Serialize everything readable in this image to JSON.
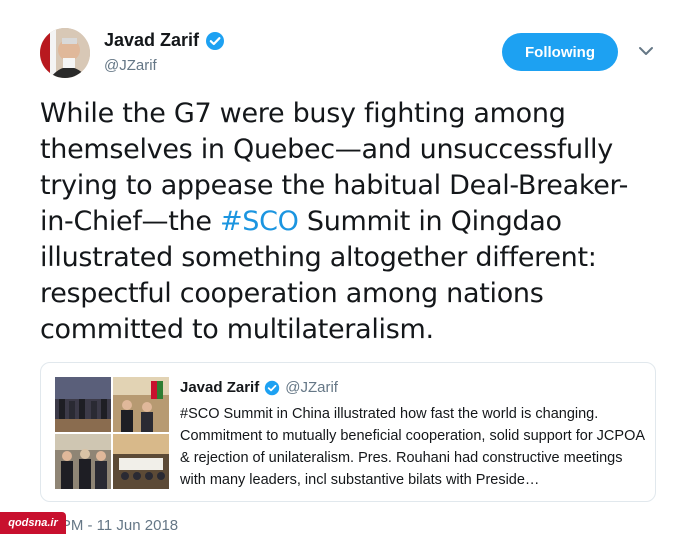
{
  "author": {
    "name": "Javad Zarif",
    "handle": "@JZarif",
    "verified_color": "#1da1f2"
  },
  "follow_button": {
    "label": "Following",
    "color": "#1da1f2"
  },
  "tweet": {
    "text_before": "While the G7 were busy fighting among themselves in Quebec—and unsuccessfully trying to appease the habitual Deal-Breaker-in-Chief—the ",
    "hashtag": "#SCO",
    "text_after": " Summit in Qingdao illustrated something altogether different: respectful cooperation among nations committed to multilateralism.",
    "hashtag_color": "#1b95e0"
  },
  "quoted_tweet": {
    "name": "Javad Zarif",
    "handle": "@JZarif",
    "text": "#SCO Summit in China illustrated how fast the world is changing. Commitment to mutually beneficial cooperation, solid support for JCPOA & rejection of unilateralism. Pres. Rouhani had constructive meetings with many leaders, incl substantive bilats with Preside…",
    "thumbnail_count": 4
  },
  "timestamp_visible": "12 PM - 11 Jun 2018",
  "watermark": {
    "text": "qodsna.ir"
  }
}
